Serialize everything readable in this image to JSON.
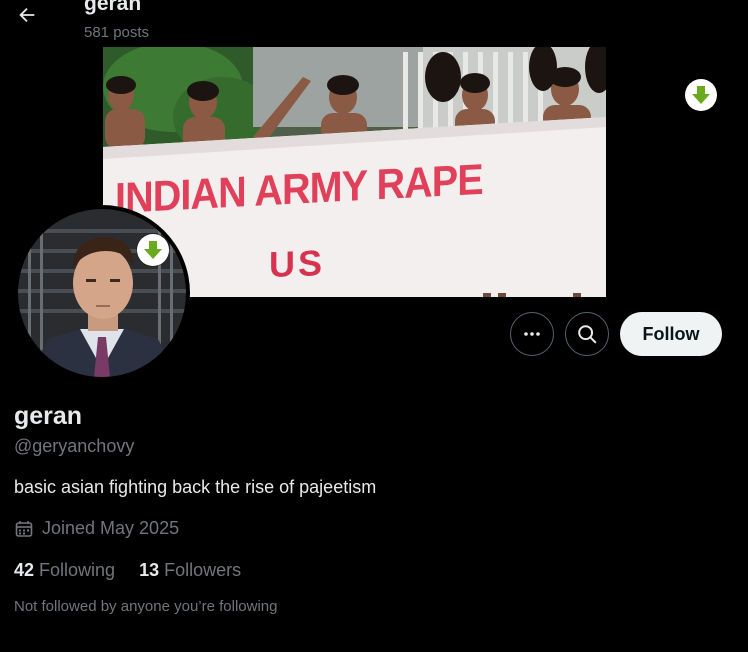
{
  "header": {
    "title": "geran",
    "post_count": "581 posts"
  },
  "banner": {
    "headline": "INDIAN ARMY RAPE",
    "subline": "US"
  },
  "profile": {
    "display_name": "geran",
    "handle": "@geryanchovy",
    "bio": "basic asian fighting back the rise of pajeetism",
    "joined": "Joined May 2025",
    "following_count": "42",
    "following_label": "Following",
    "followers_count": "13",
    "followers_label": "Followers",
    "not_followed_text": "Not followed by anyone you’re following"
  },
  "actions": {
    "more_icon": "more-horizontal-icon",
    "search_icon": "search-icon",
    "follow_label": "Follow"
  },
  "colors": {
    "background": "#000000",
    "text_primary": "#e7e9ea",
    "text_secondary": "#71767b",
    "follow_button_bg": "#eff3f4",
    "download_badge": "#6aaa1e"
  }
}
